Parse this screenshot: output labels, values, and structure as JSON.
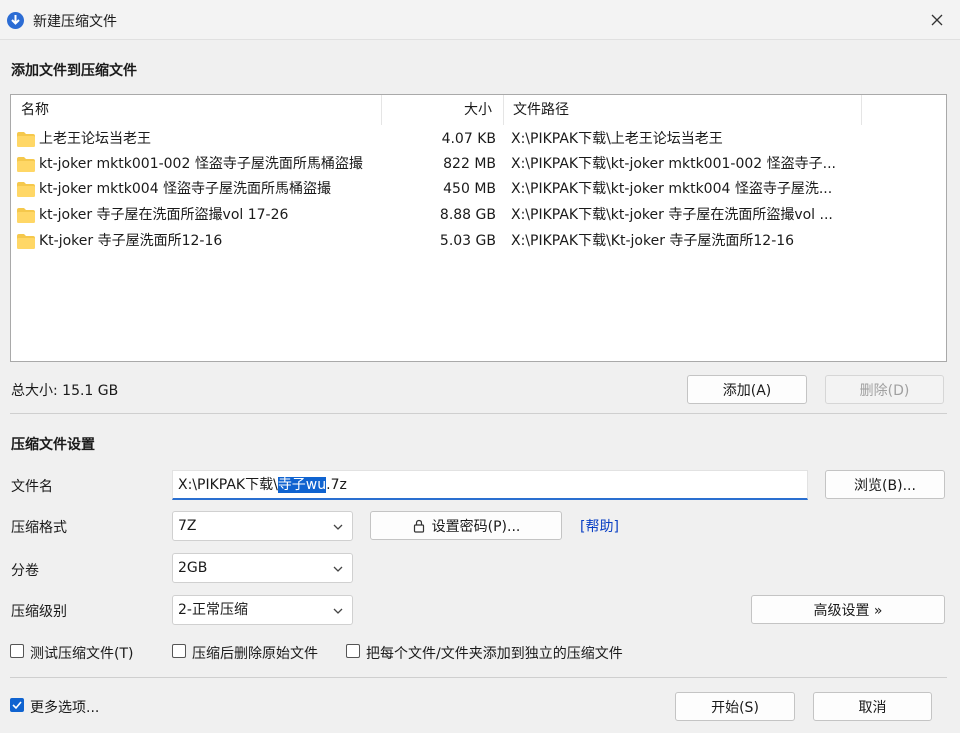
{
  "window": {
    "title": "新建压缩文件"
  },
  "add_section": {
    "title": "添加文件到压缩文件"
  },
  "file_list": {
    "columns": {
      "name": "名称",
      "size": "大小",
      "path": "文件路径"
    },
    "rows": [
      {
        "name": "上老王论坛当老王",
        "size": "4.07 KB",
        "path": "X:\\PIKPAK下载\\上老王论坛当老王"
      },
      {
        "name": "kt-joker mktk001-002 怪盗寺子屋洗面所馬桶盜撮",
        "size": "822 MB",
        "path": "X:\\PIKPAK下载\\kt-joker mktk001-002 怪盗寺子..."
      },
      {
        "name": "kt-joker mktk004 怪盜寺子屋洗面所馬桶盜撮",
        "size": "450 MB",
        "path": "X:\\PIKPAK下载\\kt-joker mktk004 怪盗寺子屋洗..."
      },
      {
        "name": "kt-joker 寺子屋在洗面所盜撮vol 17-26",
        "size": "8.88 GB",
        "path": "X:\\PIKPAK下载\\kt-joker 寺子屋在洗面所盜撮vol ..."
      },
      {
        "name": "Kt-joker 寺子屋洗面所12-16",
        "size": "5.03 GB",
        "path": "X:\\PIKPAK下载\\Kt-joker 寺子屋洗面所12-16"
      }
    ]
  },
  "total_size": "总大小: 15.1 GB",
  "buttons": {
    "add": "添加(A)",
    "delete": "删除(D)",
    "browse": "浏览(B)...",
    "set_password": "设置密码(P)...",
    "help": "[帮助]",
    "advanced": "高级设置 »",
    "start": "开始(S)",
    "cancel": "取消"
  },
  "settings": {
    "title": "压缩文件设置",
    "filename_label": "文件名",
    "filename_prefix": "X:\\PIKPAK下载\\",
    "filename_selected": "寺子wu",
    "filename_suffix": ".7z",
    "format_label": "压缩格式",
    "format_value": "7Z",
    "volume_label": "分卷",
    "volume_value": "2GB",
    "level_label": "压缩级别",
    "level_value": "2-正常压缩"
  },
  "options": {
    "test": "测试压缩文件(T)",
    "delete_after": "压缩后删除原始文件",
    "separate": "把每个文件/文件夹添加到独立的压缩文件",
    "more": "更多选项..."
  },
  "colors": {
    "accent": "#0f63d0",
    "folder": "#f5c84c",
    "link": "#0a3fc4"
  }
}
